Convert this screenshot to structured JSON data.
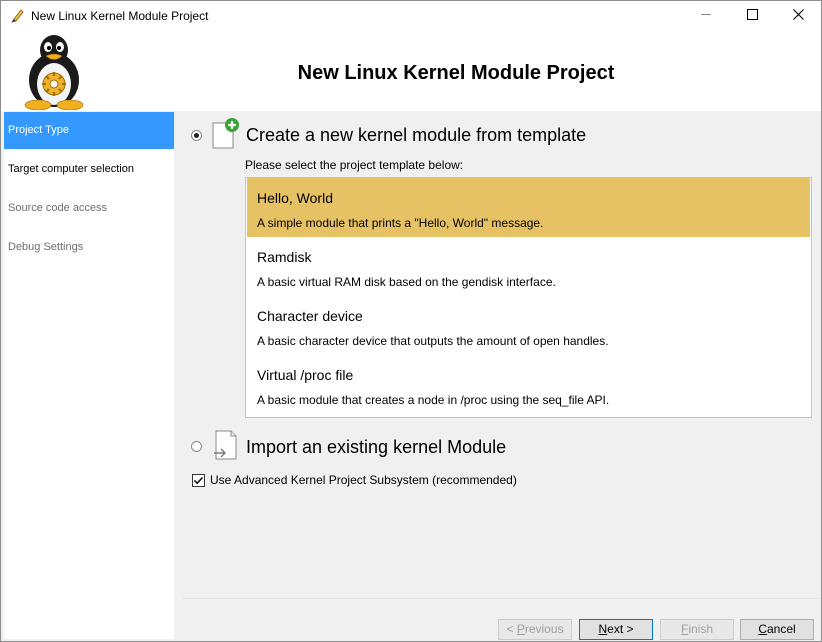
{
  "window": {
    "title": "New Linux Kernel Module Project",
    "controls": {
      "minimize": "minimize-icon",
      "maximize": "maximize-icon",
      "close": "close-icon"
    }
  },
  "header": {
    "title": "New Linux Kernel Module Project"
  },
  "sidebar": {
    "items": [
      {
        "label": "Project Type",
        "state": "active"
      },
      {
        "label": "Target computer selection",
        "state": "enabled"
      },
      {
        "label": "Source code access",
        "state": "disabled"
      },
      {
        "label": "Debug Settings",
        "state": "disabled"
      }
    ]
  },
  "main": {
    "create_option": {
      "label": "Create a new kernel module from template",
      "selected": true
    },
    "template_hint": "Please select the project template below:",
    "templates": [
      {
        "name": "Hello, World",
        "description": "A simple module that prints a \"Hello, World\" message.",
        "selected": true
      },
      {
        "name": "Ramdisk",
        "description": "A basic virtual RAM disk based on the gendisk interface.",
        "selected": false
      },
      {
        "name": "Character device",
        "description": "A basic character device that outputs the amount of open handles.",
        "selected": false
      },
      {
        "name": "Virtual /proc file",
        "description": "A basic module that creates a node in /proc using the seq_file API.",
        "selected": false
      }
    ],
    "import_option": {
      "label": "Import an existing kernel Module",
      "selected": false
    },
    "advanced_subsystem": {
      "label": "Use Advanced Kernel Project Subsystem (recommended)",
      "checked": true
    }
  },
  "footer": {
    "previous": {
      "lead": "< ",
      "key": "P",
      "rest": "revious"
    },
    "next": {
      "key": "N",
      "rest": "ext >"
    },
    "finish": {
      "key": "F",
      "rest": "inish"
    },
    "cancel": {
      "key": "C",
      "rest": "ancel"
    }
  },
  "colors": {
    "accent": "#3399ff",
    "selected_template": "#e6c265",
    "add_badge": "#3aa335"
  }
}
